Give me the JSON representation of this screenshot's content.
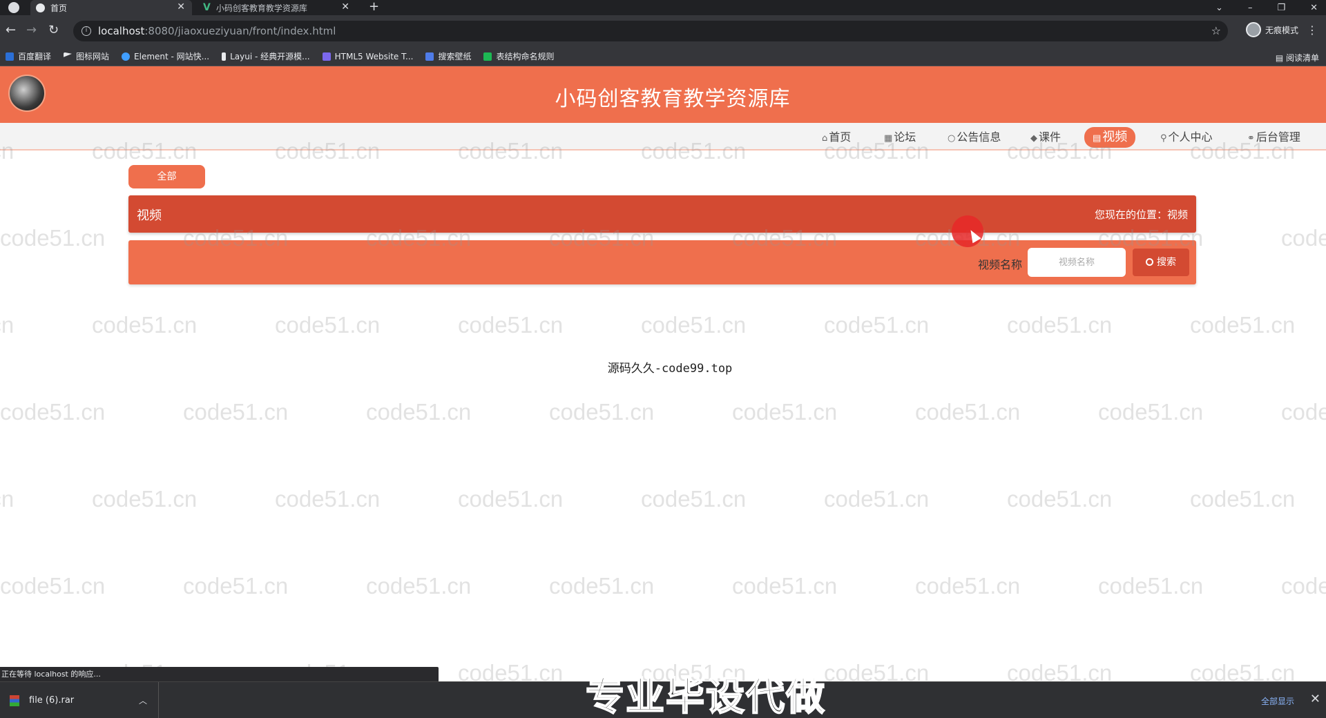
{
  "browser": {
    "tabs": [
      {
        "title": "首页",
        "active": true
      },
      {
        "title": "小码创客教育教学资源库",
        "active": false
      }
    ],
    "new_tab": "+",
    "close_glyph": "✕",
    "url_host": "localhost",
    "url_path": ":8080/jiaoxueziyuan/front/index.html",
    "profile_label": "无痕模式",
    "bookmarks": [
      "百度翻译",
      "图标网站",
      "Element - 网站快...",
      "Layui - 经典开源模...",
      "HTML5 Website T...",
      "搜索壁纸",
      "表结构命名规则"
    ],
    "reading_list": "阅读清单"
  },
  "site": {
    "title": "小码创客教育教学资源库",
    "nav": [
      {
        "label": "首页",
        "icon": "home-icon"
      },
      {
        "label": "论坛",
        "icon": "forum-icon"
      },
      {
        "label": "公告信息",
        "icon": "notice-icon"
      },
      {
        "label": "课件",
        "icon": "courseware-icon"
      },
      {
        "label": "视频",
        "icon": "video-icon",
        "active": true
      },
      {
        "label": "个人中心",
        "icon": "user-icon"
      },
      {
        "label": "后台管理",
        "icon": "link-icon"
      }
    ],
    "filter_all": "全部",
    "section_title": "视频",
    "location_text": "您现在的位置：视频",
    "search_label": "视频名称",
    "search_placeholder": "视频名称",
    "search_button": "搜索",
    "footer_text": "源码久久-code99.top",
    "accent_color": "#ef6f4d",
    "dark_accent_color": "#d34a32"
  },
  "watermark_text": "code51.cn",
  "status_text": "正在等待 localhost 的响应...",
  "downloads": {
    "file_name": "file (6).rar",
    "show_all": "全部显示"
  },
  "overlay_subtitle": "专业毕设代做"
}
